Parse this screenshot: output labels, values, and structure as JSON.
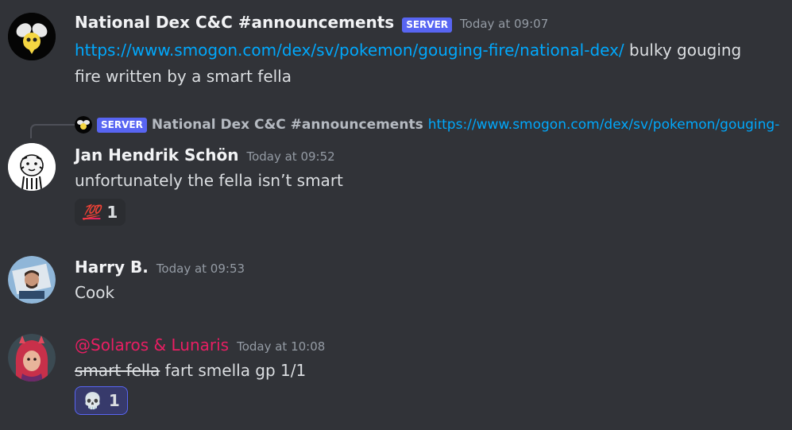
{
  "messages": [
    {
      "author": "National Dex C&C #announcements",
      "badge": "SERVER",
      "timestamp": "Today at 09:07",
      "link": "https://www.smogon.com/dex/sv/pokemon/gouging-fire/national-dex/",
      "text_line1": " bulky gouging",
      "text_line2": "fire written by a smart fella"
    },
    {
      "reply": {
        "badge": "SERVER",
        "author": "National Dex C&C #announcements",
        "link_preview": "https://www.smogon.com/dex/sv/pokemon/gouging-fire/national-dex/"
      },
      "author": "Jan Hendrik Schön",
      "timestamp": "Today at 09:52",
      "text": "unfortunately the fella isn’t smart",
      "reaction": {
        "emoji": "💯",
        "count": "1"
      }
    },
    {
      "author": "Harry B.",
      "timestamp": "Today at 09:53",
      "text": "Cook"
    },
    {
      "author": "@Solaros & Lunaris",
      "timestamp": "Today at 10:08",
      "strike_text": "smart fella",
      "text": " fart smella gp 1/1",
      "reaction": {
        "emoji": "💀",
        "count": "1"
      }
    }
  ]
}
